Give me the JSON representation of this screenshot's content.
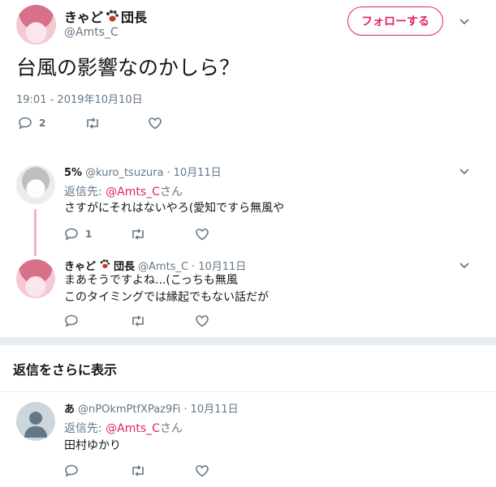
{
  "main_tweet": {
    "display_name": "きゃど",
    "display_name_suffix": "団長",
    "handle": "@Amts_C",
    "follow_label": "フォローする",
    "text": "台風の影響なのかしら？",
    "timestamp": "19:01 - 2019年10月10日",
    "reply_count": "2",
    "retweet_count": "",
    "like_count": ""
  },
  "replies": [
    {
      "display_name": "5%",
      "handle": "@kuro_tsuzura",
      "date": "10月11日",
      "reply_to_prefix": "返信先: ",
      "reply_to_handle": "@Amts_C",
      "reply_to_suffix": "さん",
      "text": "さすがにそれはないやろ(愛知ですら無風や",
      "reply_count": "1"
    },
    {
      "display_name": "きゃど",
      "display_name_suffix": "団長",
      "handle": "@Amts_C",
      "date": "10月11日",
      "text_line1": "まあそうですよね...(こっちも無風",
      "text_line2": "このタイミングでは縁起でもない話だが",
      "reply_count": ""
    }
  ],
  "show_more": {
    "label": "返信をさらに表示"
  },
  "bottom_reply": {
    "display_name": "あ",
    "handle": "@nPOkmPtfXPaz9Fi",
    "date": "10月11日",
    "reply_to_prefix": "返信先: ",
    "reply_to_handle": "@Amts_C",
    "reply_to_suffix": "さん",
    "text": "田村ゆかり"
  },
  "separator": "·",
  "colors": {
    "accent": "#e0245e",
    "muted": "#657786",
    "divider": "#e6ecf0",
    "thread_line": "#f5b2c8"
  },
  "icons": {
    "reply": "reply-icon",
    "retweet": "retweet-icon",
    "like": "like-icon",
    "more": "chevron-down-icon",
    "paw": "paw-icon"
  }
}
